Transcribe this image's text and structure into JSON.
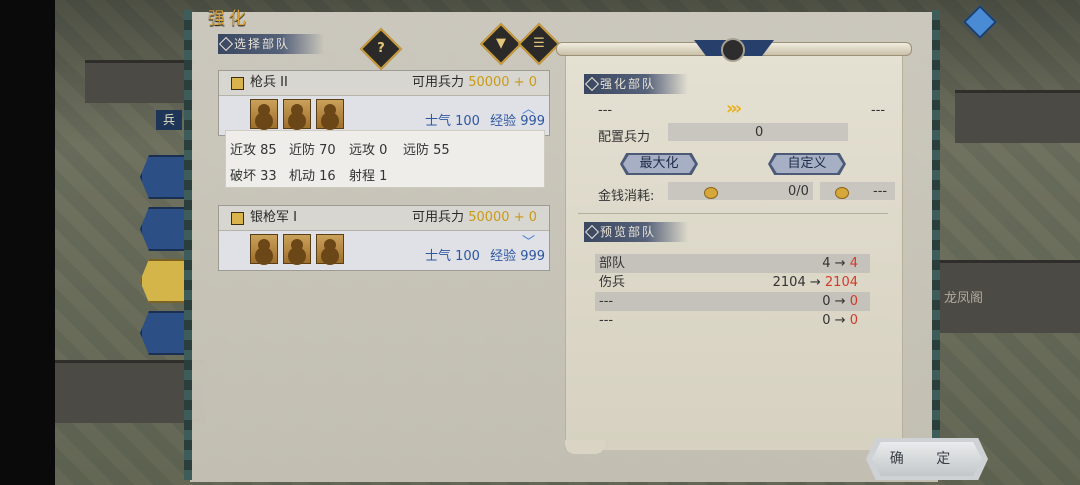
{
  "title": "强化",
  "left_panel": {
    "header": "选择部队",
    "help_icon": "question-icon",
    "filter_icon": "filter-icon",
    "list_icon": "list-icon"
  },
  "side_tab_label": "兵",
  "units": [
    {
      "name": "枪兵 II",
      "avail_label": "可用兵力",
      "avail_value": "50000 + 0",
      "morale": "士气 100",
      "exp": "经验 999",
      "expanded": true,
      "stats": [
        {
          "label": "近攻",
          "value": "85"
        },
        {
          "label": "近防",
          "value": "70"
        },
        {
          "label": "远攻",
          "value": "0"
        },
        {
          "label": "远防",
          "value": "55"
        },
        {
          "label": "破坏",
          "value": "33"
        },
        {
          "label": "机动",
          "value": "16"
        },
        {
          "label": "射程",
          "value": "1"
        }
      ]
    },
    {
      "name": "银枪军 I",
      "avail_label": "可用兵力",
      "avail_value": "50000 + 0",
      "morale": "士气 100",
      "exp": "经验 999",
      "expanded": false
    }
  ],
  "right_panel": {
    "enhance_header": "强化部队",
    "from_unit": "---",
    "to_unit": "---",
    "troops_label": "配置兵力",
    "troops_value": "0",
    "max_button": "最大化",
    "custom_button": "自定义",
    "cost_label": "金钱消耗:",
    "cost_value": "0/0",
    "cost_extra": "---",
    "preview_header": "预览部队",
    "preview_rows": [
      {
        "label": "部队",
        "from": "4",
        "to": "4"
      },
      {
        "label": "伤兵",
        "from": "2104",
        "to": "2104"
      },
      {
        "label": "---",
        "from": "0",
        "to": "0"
      },
      {
        "label": "---",
        "from": "0",
        "to": "0"
      }
    ],
    "arrow_symbol": "→"
  },
  "bg_building_label": "龙凤阁",
  "confirm_button": "确 定",
  "colors": {
    "accent_gold": "#c99a18",
    "accent_red": "#d23a2a",
    "accent_blue": "#2d57a0"
  }
}
